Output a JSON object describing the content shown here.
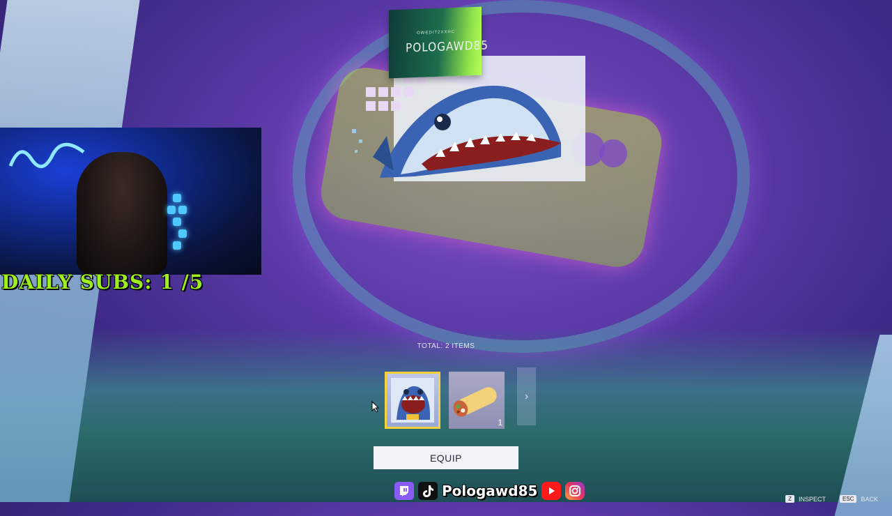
{
  "nameplate": {
    "small_text": "OWEDIT2XXHC",
    "player_name": "POLOGAWD85"
  },
  "overlay": {
    "daily_subs": "DAILY SUBS: 1 /5",
    "social_handle": "Pologawd85"
  },
  "reward": {
    "total_label": "TOTAL: 2 ITEMS",
    "items": [
      {
        "name": "shark-spray-item",
        "selected": true,
        "count": ""
      },
      {
        "name": "burrito-item",
        "selected": false,
        "count": "1"
      }
    ],
    "equip_label": "EQUIP"
  },
  "hints": {
    "inspect_key": "Z",
    "inspect_label": "INSPECT",
    "back_key": "ESC",
    "back_label": "BACK"
  },
  "icons": [
    "twitch-icon",
    "tiktok-icon",
    "youtube-icon",
    "instagram-icon",
    "chevron-right-icon",
    "mouse-cursor-icon"
  ],
  "colors": {
    "accent_selected": "#f6d23a",
    "daily_subs_text": "#9df01e",
    "background_purple": "#5b3aa8"
  }
}
